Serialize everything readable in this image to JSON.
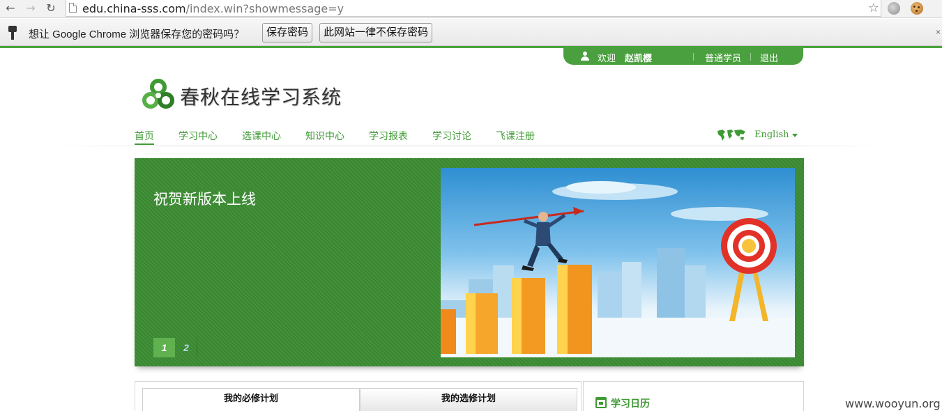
{
  "browser": {
    "url_host": "edu.china-sss.com",
    "url_path": "/index.win?showmessage=y",
    "password_prompt": {
      "message": "想让 Google Chrome 浏览器保存您的密码吗？",
      "save_label": "保存密码",
      "never_label": "此网站一律不保存密码",
      "close_glyph": "×"
    }
  },
  "userbar": {
    "welcome": "欢迎",
    "username": "赵凯樱",
    "role": "普通学员",
    "logout": "退出"
  },
  "site": {
    "title": "春秋在线学习系统",
    "accent_color": "#3f9a34"
  },
  "nav": {
    "items": [
      {
        "label": "首页",
        "active": true
      },
      {
        "label": "学习中心"
      },
      {
        "label": "选课中心"
      },
      {
        "label": "知识中心"
      },
      {
        "label": "学习报表"
      },
      {
        "label": "学习讨论"
      },
      {
        "label": "飞课注册"
      }
    ],
    "language": "English"
  },
  "banner": {
    "caption": "祝贺新版本上线",
    "pages": [
      "1",
      "2"
    ],
    "current_page": "1"
  },
  "panels": {
    "tabs": [
      "我的必修计划",
      "我的选修计划"
    ],
    "calendar_title": "学习日历"
  },
  "watermark": "www.wooyun.org"
}
